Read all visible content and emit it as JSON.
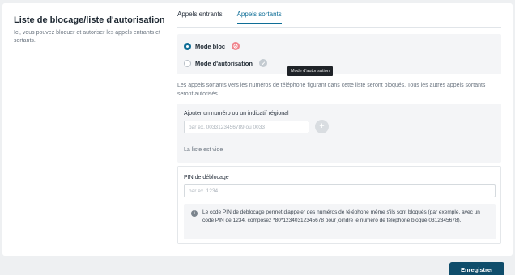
{
  "section": {
    "title": "Liste de blocage/liste d'autorisation",
    "description": "Ici, vous pouvez bloquer et autoriser les appels entrants et sortants."
  },
  "tabs": [
    {
      "label": "Appels entrants",
      "active": false
    },
    {
      "label": "Appels sortants",
      "active": true
    }
  ],
  "modes": {
    "block_label": "Mode bloc",
    "block_icon": "block-icon",
    "block_selected": true,
    "auth_label": "Mode d'autorisation",
    "auth_icon": "check-icon",
    "tooltip": "Mode d'autorisation"
  },
  "info_text": "Les appels sortants vers les numéros de téléphone figurant dans cette liste seront bloqués. Tous les autres appels sortants seront autorisés.",
  "add_number": {
    "label": "Ajouter un numéro ou un indicatif régional",
    "placeholder": "par ex. 0033123456789 ou 0033",
    "add_icon": "plus-icon",
    "empty_text": "La liste est vide"
  },
  "pin": {
    "label": "PIN de déblocage",
    "placeholder": "par ex. 1234",
    "note_icon": "info-icon",
    "note": "Le code PIN de déblocage permet d'appeler des numéros de téléphone même s'ils sont bloqués (par exemple, avec un code PIN de 1234, composez *80*12340312345678 pour joindre le numéro de téléphone bloqué 0312345678)."
  },
  "footer": {
    "save_label": "Enregistrer"
  },
  "colors": {
    "accent": "#0f6e97",
    "primary_button": "#0f4d6b",
    "block_icon": "#f0848c"
  }
}
